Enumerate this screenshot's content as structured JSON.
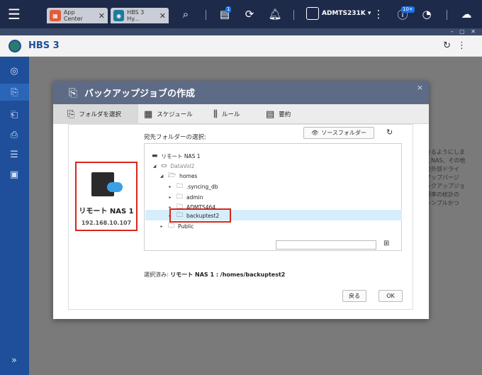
{
  "topbar": {
    "tabs": [
      {
        "label": "App Center",
        "close": "✕"
      },
      {
        "label": "HBS 3 Hy...",
        "close": "✕"
      }
    ],
    "notification_badge": "1",
    "firmware_badge": "10+",
    "username": "ADMTS231K ▾"
  },
  "app": {
    "title": "HBS 3"
  },
  "background_text": "きるようにしま\nこNAS、その他\nの外部ドライ\nアップバージ\nックアップジョ\n用率の統計の\nシンプルかつ",
  "dialog": {
    "title": "バックアップジョブの作成",
    "close": "×",
    "steps": [
      {
        "label": "フォルダを選択"
      },
      {
        "label": "スケジュール"
      },
      {
        "label": "ルール"
      },
      {
        "label": "要約"
      }
    ],
    "source_nas": {
      "name": "リモート NAS 1",
      "ip": "192.168.10.107"
    },
    "dest_label": "宛先フォルダーの選択:",
    "source_folder_button": "ソースフォルダー",
    "tree": [
      {
        "label": "リモート NAS 1"
      },
      {
        "label": "DataVol2"
      },
      {
        "label": "homes"
      },
      {
        "label": ".syncing_db"
      },
      {
        "label": "admin"
      },
      {
        "label": "ADMTS464"
      },
      {
        "label": "backuptest2"
      },
      {
        "label": "Public"
      }
    ],
    "selected_prefix": "選択済み: ",
    "selected_value": "リモート NAS 1 : /homes/backuptest2",
    "back_button": "戻る",
    "ok_button": "OK"
  }
}
